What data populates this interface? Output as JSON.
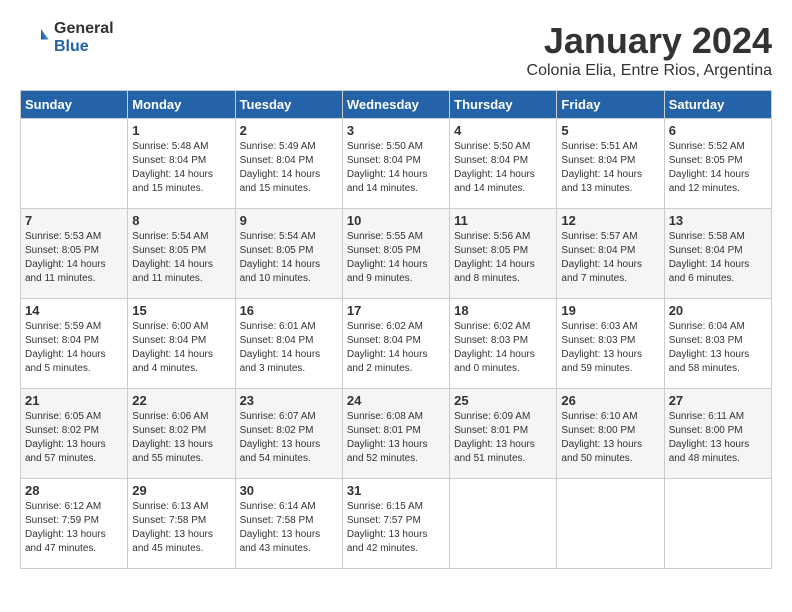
{
  "logo": {
    "general": "General",
    "blue": "Blue"
  },
  "title": "January 2024",
  "subtitle": "Colonia Elia, Entre Rios, Argentina",
  "days_of_week": [
    "Sunday",
    "Monday",
    "Tuesday",
    "Wednesday",
    "Thursday",
    "Friday",
    "Saturday"
  ],
  "weeks": [
    [
      {
        "day": "",
        "sunrise": "",
        "sunset": "",
        "daylight": ""
      },
      {
        "day": "1",
        "sunrise": "Sunrise: 5:48 AM",
        "sunset": "Sunset: 8:04 PM",
        "daylight": "Daylight: 14 hours and 15 minutes."
      },
      {
        "day": "2",
        "sunrise": "Sunrise: 5:49 AM",
        "sunset": "Sunset: 8:04 PM",
        "daylight": "Daylight: 14 hours and 15 minutes."
      },
      {
        "day": "3",
        "sunrise": "Sunrise: 5:50 AM",
        "sunset": "Sunset: 8:04 PM",
        "daylight": "Daylight: 14 hours and 14 minutes."
      },
      {
        "day": "4",
        "sunrise": "Sunrise: 5:50 AM",
        "sunset": "Sunset: 8:04 PM",
        "daylight": "Daylight: 14 hours and 14 minutes."
      },
      {
        "day": "5",
        "sunrise": "Sunrise: 5:51 AM",
        "sunset": "Sunset: 8:04 PM",
        "daylight": "Daylight: 14 hours and 13 minutes."
      },
      {
        "day": "6",
        "sunrise": "Sunrise: 5:52 AM",
        "sunset": "Sunset: 8:05 PM",
        "daylight": "Daylight: 14 hours and 12 minutes."
      }
    ],
    [
      {
        "day": "7",
        "sunrise": "Sunrise: 5:53 AM",
        "sunset": "Sunset: 8:05 PM",
        "daylight": "Daylight: 14 hours and 11 minutes."
      },
      {
        "day": "8",
        "sunrise": "Sunrise: 5:54 AM",
        "sunset": "Sunset: 8:05 PM",
        "daylight": "Daylight: 14 hours and 11 minutes."
      },
      {
        "day": "9",
        "sunrise": "Sunrise: 5:54 AM",
        "sunset": "Sunset: 8:05 PM",
        "daylight": "Daylight: 14 hours and 10 minutes."
      },
      {
        "day": "10",
        "sunrise": "Sunrise: 5:55 AM",
        "sunset": "Sunset: 8:05 PM",
        "daylight": "Daylight: 14 hours and 9 minutes."
      },
      {
        "day": "11",
        "sunrise": "Sunrise: 5:56 AM",
        "sunset": "Sunset: 8:05 PM",
        "daylight": "Daylight: 14 hours and 8 minutes."
      },
      {
        "day": "12",
        "sunrise": "Sunrise: 5:57 AM",
        "sunset": "Sunset: 8:04 PM",
        "daylight": "Daylight: 14 hours and 7 minutes."
      },
      {
        "day": "13",
        "sunrise": "Sunrise: 5:58 AM",
        "sunset": "Sunset: 8:04 PM",
        "daylight": "Daylight: 14 hours and 6 minutes."
      }
    ],
    [
      {
        "day": "14",
        "sunrise": "Sunrise: 5:59 AM",
        "sunset": "Sunset: 8:04 PM",
        "daylight": "Daylight: 14 hours and 5 minutes."
      },
      {
        "day": "15",
        "sunrise": "Sunrise: 6:00 AM",
        "sunset": "Sunset: 8:04 PM",
        "daylight": "Daylight: 14 hours and 4 minutes."
      },
      {
        "day": "16",
        "sunrise": "Sunrise: 6:01 AM",
        "sunset": "Sunset: 8:04 PM",
        "daylight": "Daylight: 14 hours and 3 minutes."
      },
      {
        "day": "17",
        "sunrise": "Sunrise: 6:02 AM",
        "sunset": "Sunset: 8:04 PM",
        "daylight": "Daylight: 14 hours and 2 minutes."
      },
      {
        "day": "18",
        "sunrise": "Sunrise: 6:02 AM",
        "sunset": "Sunset: 8:03 PM",
        "daylight": "Daylight: 14 hours and 0 minutes."
      },
      {
        "day": "19",
        "sunrise": "Sunrise: 6:03 AM",
        "sunset": "Sunset: 8:03 PM",
        "daylight": "Daylight: 13 hours and 59 minutes."
      },
      {
        "day": "20",
        "sunrise": "Sunrise: 6:04 AM",
        "sunset": "Sunset: 8:03 PM",
        "daylight": "Daylight: 13 hours and 58 minutes."
      }
    ],
    [
      {
        "day": "21",
        "sunrise": "Sunrise: 6:05 AM",
        "sunset": "Sunset: 8:02 PM",
        "daylight": "Daylight: 13 hours and 57 minutes."
      },
      {
        "day": "22",
        "sunrise": "Sunrise: 6:06 AM",
        "sunset": "Sunset: 8:02 PM",
        "daylight": "Daylight: 13 hours and 55 minutes."
      },
      {
        "day": "23",
        "sunrise": "Sunrise: 6:07 AM",
        "sunset": "Sunset: 8:02 PM",
        "daylight": "Daylight: 13 hours and 54 minutes."
      },
      {
        "day": "24",
        "sunrise": "Sunrise: 6:08 AM",
        "sunset": "Sunset: 8:01 PM",
        "daylight": "Daylight: 13 hours and 52 minutes."
      },
      {
        "day": "25",
        "sunrise": "Sunrise: 6:09 AM",
        "sunset": "Sunset: 8:01 PM",
        "daylight": "Daylight: 13 hours and 51 minutes."
      },
      {
        "day": "26",
        "sunrise": "Sunrise: 6:10 AM",
        "sunset": "Sunset: 8:00 PM",
        "daylight": "Daylight: 13 hours and 50 minutes."
      },
      {
        "day": "27",
        "sunrise": "Sunrise: 6:11 AM",
        "sunset": "Sunset: 8:00 PM",
        "daylight": "Daylight: 13 hours and 48 minutes."
      }
    ],
    [
      {
        "day": "28",
        "sunrise": "Sunrise: 6:12 AM",
        "sunset": "Sunset: 7:59 PM",
        "daylight": "Daylight: 13 hours and 47 minutes."
      },
      {
        "day": "29",
        "sunrise": "Sunrise: 6:13 AM",
        "sunset": "Sunset: 7:58 PM",
        "daylight": "Daylight: 13 hours and 45 minutes."
      },
      {
        "day": "30",
        "sunrise": "Sunrise: 6:14 AM",
        "sunset": "Sunset: 7:58 PM",
        "daylight": "Daylight: 13 hours and 43 minutes."
      },
      {
        "day": "31",
        "sunrise": "Sunrise: 6:15 AM",
        "sunset": "Sunset: 7:57 PM",
        "daylight": "Daylight: 13 hours and 42 minutes."
      },
      {
        "day": "",
        "sunrise": "",
        "sunset": "",
        "daylight": ""
      },
      {
        "day": "",
        "sunrise": "",
        "sunset": "",
        "daylight": ""
      },
      {
        "day": "",
        "sunrise": "",
        "sunset": "",
        "daylight": ""
      }
    ]
  ]
}
